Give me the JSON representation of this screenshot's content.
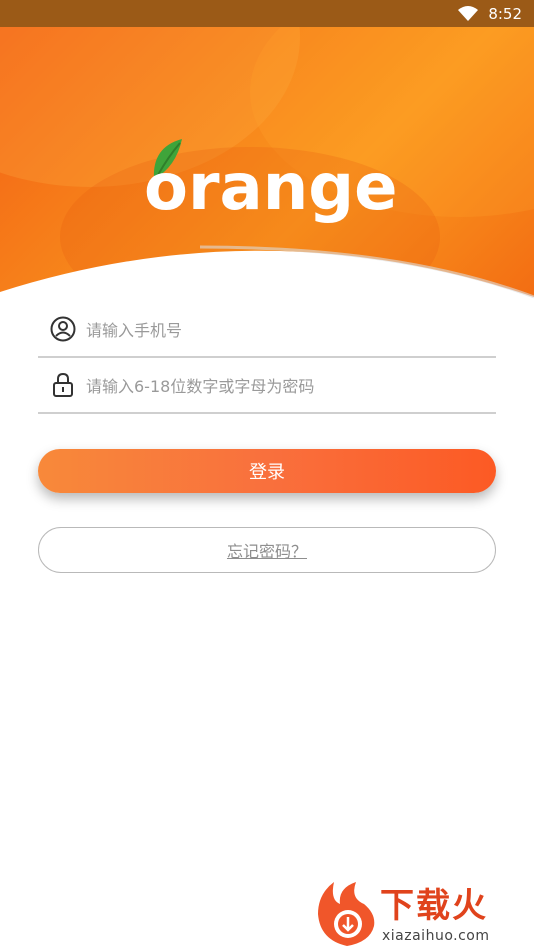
{
  "status_bar": {
    "time": "8:52"
  },
  "brand": {
    "logo_text": "orange",
    "accent": "#f6761b",
    "leaf_color": "#3fa43a"
  },
  "form": {
    "phone_placeholder": "请输入手机号",
    "password_placeholder": "请输入6-18位数字或字母为密码",
    "login_label": "登录",
    "forgot_label": "忘记密码？"
  },
  "watermark": {
    "title": "下载火",
    "url": "xiazaihuo.com"
  }
}
